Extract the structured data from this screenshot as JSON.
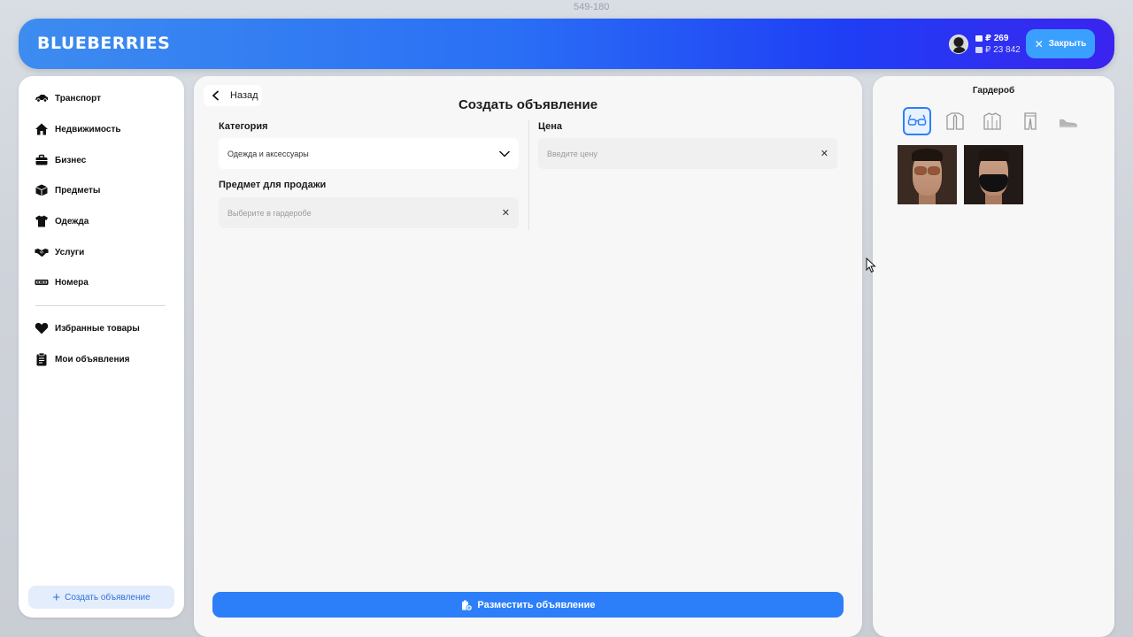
{
  "background_hint": "549-180",
  "header": {
    "logo": "BLUEBERRIES",
    "balance_primary": "₽ 269",
    "balance_secondary": "₽ 23 842",
    "close_label": "Закрыть"
  },
  "sidebar": {
    "items": [
      {
        "label": "Транспорт",
        "icon": "car-icon"
      },
      {
        "label": "Недвижимость",
        "icon": "house-icon"
      },
      {
        "label": "Бизнес",
        "icon": "briefcase-icon"
      },
      {
        "label": "Предметы",
        "icon": "box-icon"
      },
      {
        "label": "Одежда",
        "icon": "tshirt-icon"
      },
      {
        "label": "Услуги",
        "icon": "handshake-icon"
      },
      {
        "label": "Номера",
        "icon": "license-plate-icon"
      }
    ],
    "secondary": [
      {
        "label": "Избранные товары",
        "icon": "heart-icon"
      },
      {
        "label": "Мои объявления",
        "icon": "clipboard-icon"
      }
    ],
    "create_label": "Создать объявление"
  },
  "form": {
    "back_label": "Назад",
    "title": "Создать объявление",
    "category_label": "Категория",
    "category_value": "Одежда и аксессуары",
    "item_label": "Предмет для продажи",
    "item_placeholder": "Выберите в гардеробе",
    "price_label": "Цена",
    "price_placeholder": "Введите цену",
    "submit_label": "Разместить объявление"
  },
  "wardrobe": {
    "title": "Гардероб",
    "tabs": [
      "glasses-icon",
      "jacket-icon",
      "coat-icon",
      "pants-icon",
      "shoe-icon"
    ],
    "active_tab": 0,
    "items": [
      "sunglasses-item",
      "mask-item"
    ]
  },
  "colors": {
    "accent": "#2d7ff9",
    "header_start": "#3d8cf0",
    "header_end": "#3a24ef"
  }
}
